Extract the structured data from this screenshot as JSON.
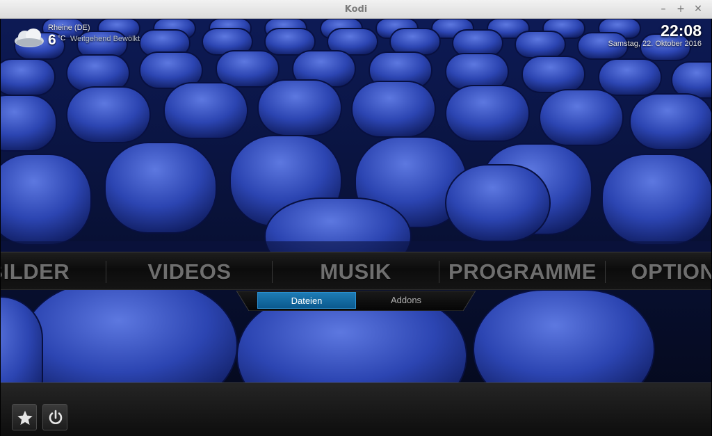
{
  "window": {
    "title": "Kodi",
    "minimize_icon": "–",
    "maximize_icon": "+",
    "close_icon": "✕"
  },
  "weather": {
    "location": "Rheine (DE)",
    "temperature": "6",
    "unit": "°C",
    "condition": "Weitgehend Bewölkt",
    "icon": "cloud-icon"
  },
  "clock": {
    "time": "22:08",
    "date": "Samstag, 22. Oktober 2016"
  },
  "main_menu": {
    "items": [
      {
        "label": "BILDER"
      },
      {
        "label": "VIDEOS"
      },
      {
        "label": "MUSIK"
      },
      {
        "label": "PROGRAMME"
      },
      {
        "label": "OPTIONEN"
      }
    ]
  },
  "submenu": {
    "items": [
      {
        "label": "Dateien",
        "active": true
      },
      {
        "label": "Addons",
        "active": false
      }
    ]
  },
  "bottom_bar": {
    "buttons": [
      {
        "icon": "star-icon"
      },
      {
        "icon": "power-icon"
      }
    ]
  },
  "colors": {
    "accent": "#1b78b3",
    "menu_text": "#6e6e6e",
    "background_seat": "#2a3f9a"
  }
}
